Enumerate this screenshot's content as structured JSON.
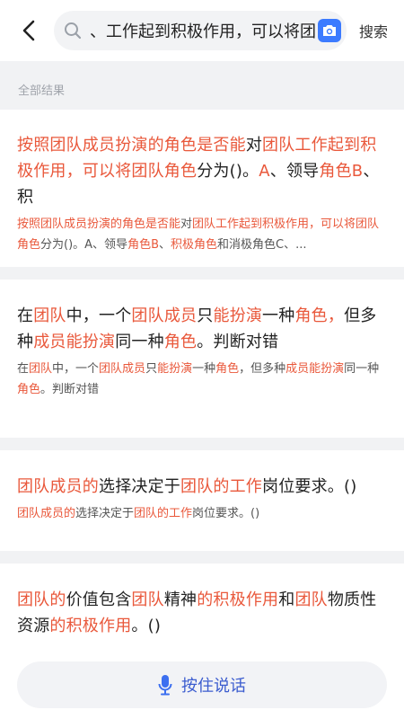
{
  "search": {
    "query": "、工作起到积极作用，可以将团",
    "button": "搜索"
  },
  "section_label": "全部结果",
  "results": [
    {
      "title": [
        {
          "t": "按照团队成员扮演的角色是否能",
          "h": true
        },
        {
          "t": "对",
          "h": false
        },
        {
          "t": "团队工作起到积极作用，可以将团队角色",
          "h": true
        },
        {
          "t": "分为()。",
          "h": false
        },
        {
          "t": "A",
          "h": true
        },
        {
          "t": "、领导",
          "h": false
        },
        {
          "t": "角色B",
          "h": true
        },
        {
          "t": "、积",
          "h": false
        }
      ],
      "snippet": [
        {
          "t": "按照团队成员扮演的角色是否能",
          "h": true
        },
        {
          "t": "对",
          "h": false
        },
        {
          "t": "团队工作起到积极作用，可以将团队角色",
          "h": true
        },
        {
          "t": "分为()。A、领导",
          "h": false
        },
        {
          "t": "角色B",
          "h": true
        },
        {
          "t": "、",
          "h": false
        },
        {
          "t": "积极角色",
          "h": true
        },
        {
          "t": "和消极角色C、...",
          "h": false
        }
      ]
    },
    {
      "title": [
        {
          "t": "在",
          "h": false
        },
        {
          "t": "团队",
          "h": true
        },
        {
          "t": "中，一个",
          "h": false
        },
        {
          "t": "团队成员",
          "h": true
        },
        {
          "t": "只",
          "h": false
        },
        {
          "t": "能扮演",
          "h": true
        },
        {
          "t": "一种",
          "h": false
        },
        {
          "t": "角色，",
          "h": true
        },
        {
          "t": "但多种",
          "h": false
        },
        {
          "t": "成员能扮演",
          "h": true
        },
        {
          "t": "同一种",
          "h": false
        },
        {
          "t": "角色",
          "h": true
        },
        {
          "t": "。判断对错",
          "h": false
        }
      ],
      "snippet": [
        {
          "t": "在",
          "h": false
        },
        {
          "t": "团队",
          "h": true
        },
        {
          "t": "中，一个",
          "h": false
        },
        {
          "t": "团队成员",
          "h": true
        },
        {
          "t": "只",
          "h": false
        },
        {
          "t": "能扮演",
          "h": true
        },
        {
          "t": "一种",
          "h": false
        },
        {
          "t": "角色",
          "h": true
        },
        {
          "t": "，但多种",
          "h": false
        },
        {
          "t": "成员能扮演",
          "h": true
        },
        {
          "t": "同一种",
          "h": false
        },
        {
          "t": "角色",
          "h": true
        },
        {
          "t": "。判断对错",
          "h": false
        }
      ]
    },
    {
      "title": [
        {
          "t": "团队成员的",
          "h": true
        },
        {
          "t": "选择决定于",
          "h": false
        },
        {
          "t": "团队的工作",
          "h": true
        },
        {
          "t": "岗位要求。()",
          "h": false
        }
      ],
      "snippet": [
        {
          "t": "团队成员的",
          "h": true
        },
        {
          "t": "选择决定于",
          "h": false
        },
        {
          "t": "团队的工作",
          "h": true
        },
        {
          "t": "岗位要求。()",
          "h": false
        }
      ]
    },
    {
      "title": [
        {
          "t": "团队的",
          "h": true
        },
        {
          "t": "价值包含",
          "h": false
        },
        {
          "t": "团队",
          "h": true
        },
        {
          "t": "精神",
          "h": false
        },
        {
          "t": "的积极作用",
          "h": true
        },
        {
          "t": "和",
          "h": false
        },
        {
          "t": "团队",
          "h": true
        },
        {
          "t": "物质性资源",
          "h": false
        },
        {
          "t": "的积极作用",
          "h": true
        },
        {
          "t": "。()",
          "h": false
        }
      ],
      "snippet": []
    }
  ],
  "voice": {
    "label": "按住说话"
  },
  "colors": {
    "highlight": "#e9583b",
    "accent": "#3c7bff",
    "voice_text": "#3b5ccf"
  }
}
